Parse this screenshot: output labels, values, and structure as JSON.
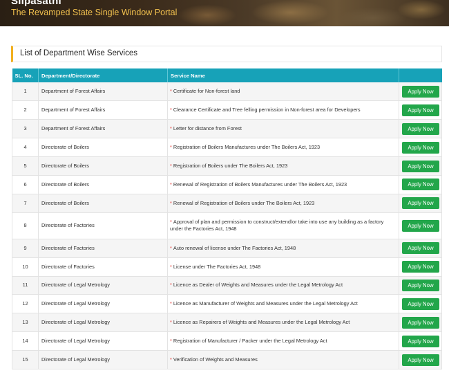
{
  "banner": {
    "brand": "Silpasathi",
    "tagline": "The Revamped State Single Window Portal"
  },
  "section": {
    "title": "List of Department Wise Services"
  },
  "table": {
    "headers": [
      "SL. No.",
      "Department/Directorate",
      "Service Name",
      ""
    ],
    "apply_label": "Apply Now",
    "rows": [
      {
        "sl": "1",
        "dept": "Department of Forest Affairs",
        "service": "Certificate for Non-forest land"
      },
      {
        "sl": "2",
        "dept": "Department of Forest Affairs",
        "service": "Clearance Certificate and Tree felling permission in Non-forest area for Developers"
      },
      {
        "sl": "3",
        "dept": "Department of Forest Affairs",
        "service": "Letter for distance from Forest"
      },
      {
        "sl": "4",
        "dept": "Directorate of Boilers",
        "service": "Registration of Boilers Manufactures under The Boilers Act, 1923"
      },
      {
        "sl": "5",
        "dept": "Directorate of Boilers",
        "service": "Registration of Boilers under The Boilers Act, 1923"
      },
      {
        "sl": "6",
        "dept": "Directorate of Boilers",
        "service": "Renewal of Registration of Boilers Manufactures under The Boilers Act, 1923"
      },
      {
        "sl": "7",
        "dept": "Directorate of Boilers",
        "service": "Renewal of Registration of Boilers under The Boilers Act, 1923"
      },
      {
        "sl": "8",
        "dept": "Directorate of Factories",
        "service": "Approval of plan and permission to construct/extend/or take into use any building as a factory under the Factories Act, 1948"
      },
      {
        "sl": "9",
        "dept": "Directorate of Factories",
        "service": "Auto renewal of license under The Factories Act, 1948"
      },
      {
        "sl": "10",
        "dept": "Directorate of Factories",
        "service": "License under The Factories Act, 1948"
      },
      {
        "sl": "11",
        "dept": "Directorate of Legal Metrology",
        "service": "Licence as Dealer of Weights and Measures under the Legal Metrology Act"
      },
      {
        "sl": "12",
        "dept": "Directorate of Legal Metrology",
        "service": "Licence as Manufacturer of Weights and Measures under the Legal Metrology Act"
      },
      {
        "sl": "13",
        "dept": "Directorate of Legal Metrology",
        "service": "Licence as Repairers of Weights and Measures under the Legal Metrology Act"
      },
      {
        "sl": "14",
        "dept": "Directorate of Legal Metrology",
        "service": "Registration of Manufacturer / Packer under the Legal Metrology Act"
      },
      {
        "sl": "15",
        "dept": "Directorate of Legal Metrology",
        "service": "Verification of Weights and Measures"
      }
    ]
  },
  "colors": {
    "header_bg": "#17a2b8",
    "button_bg": "#22a64a",
    "accent": "#f2b01e",
    "required_star": "#e53935"
  }
}
